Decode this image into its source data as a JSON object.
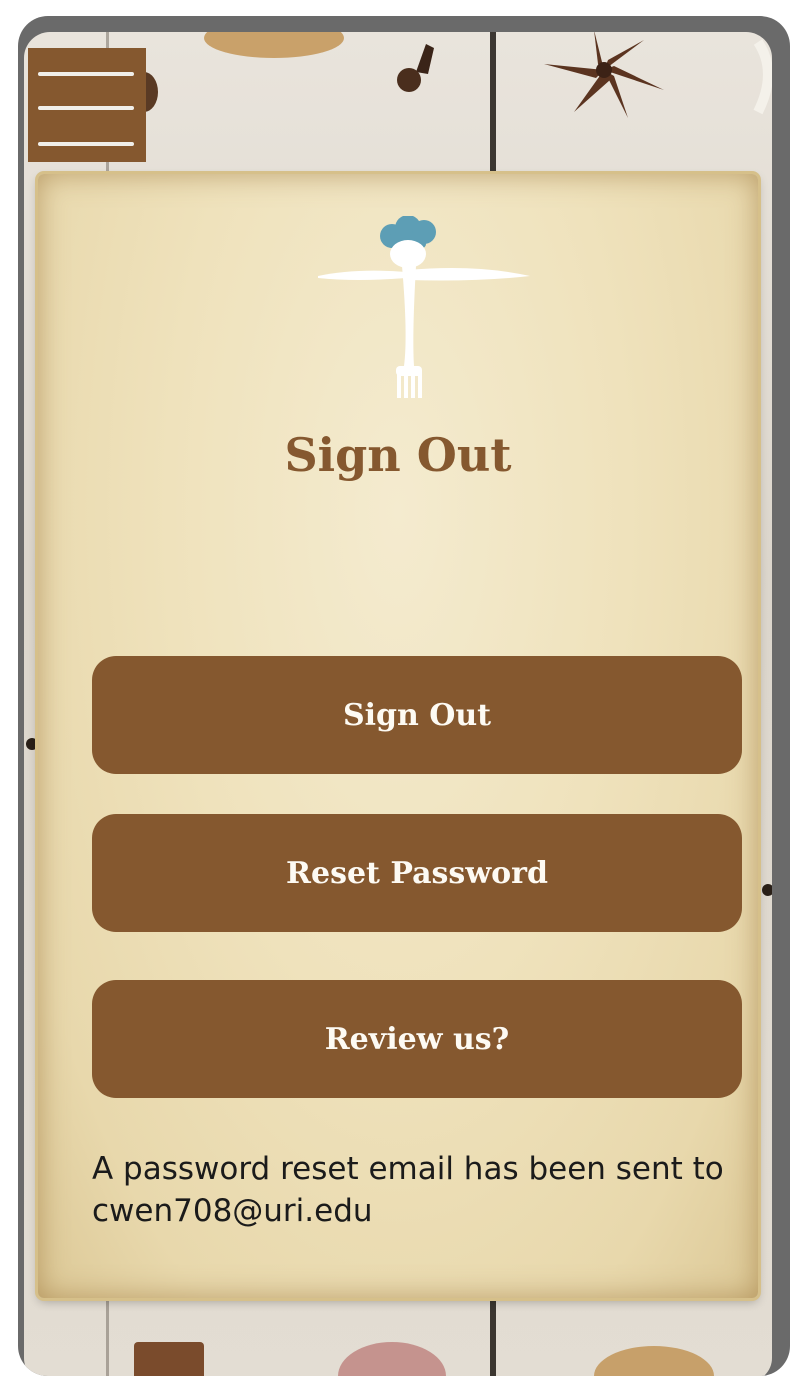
{
  "menu": {
    "icon": "hamburger-menu-icon"
  },
  "logo": {
    "icon": "chef-hat-fork-knife-icon"
  },
  "page": {
    "title": "Sign Out"
  },
  "buttons": {
    "sign_out": "Sign Out",
    "reset_password": "Reset Password",
    "review": "Review us?"
  },
  "status": {
    "message": "A password reset email has been sent to cwen708@uri.edu"
  },
  "colors": {
    "accent": "#85582f",
    "paper": "#efe2bc",
    "button_text": "#fdfaf3",
    "hat": "#5d9eb5"
  }
}
